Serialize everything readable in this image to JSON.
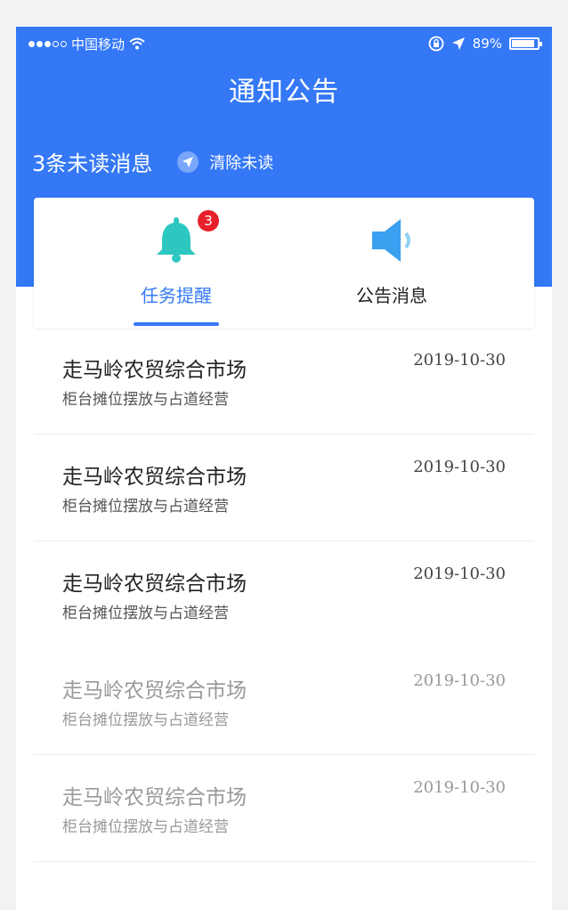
{
  "status_bar": {
    "carrier": "中国移动",
    "battery": "89%"
  },
  "header": {
    "title": "通知公告",
    "unread_text": "3条未读消息",
    "clear_label": "清除未读"
  },
  "tabs": [
    {
      "label": "任务提醒",
      "badge": "3",
      "active": true
    },
    {
      "label": "公告消息",
      "active": false
    }
  ],
  "notices": [
    {
      "title": "走马岭农贸综合市场",
      "subtitle": "柜台摊位摆放与占道经营",
      "date": "2019-10-30",
      "read": false
    },
    {
      "title": "走马岭农贸综合市场",
      "subtitle": "柜台摊位摆放与占道经营",
      "date": "2019-10-30",
      "read": false
    },
    {
      "title": "走马岭农贸综合市场",
      "subtitle": "柜台摊位摆放与占道经营",
      "date": "2019-10-30",
      "read": false
    },
    {
      "title": "走马岭农贸综合市场",
      "subtitle": "柜台摊位摆放与占道经营",
      "date": "2019-10-30",
      "read": true
    },
    {
      "title": "走马岭农贸综合市场",
      "subtitle": "柜台摊位摆放与占道经营",
      "date": "2019-10-30",
      "read": true
    }
  ],
  "colors": {
    "accent": "#3478f6",
    "bell": "#2ec7c0",
    "speaker": "#3aa0f0",
    "badge": "#e8202a"
  }
}
